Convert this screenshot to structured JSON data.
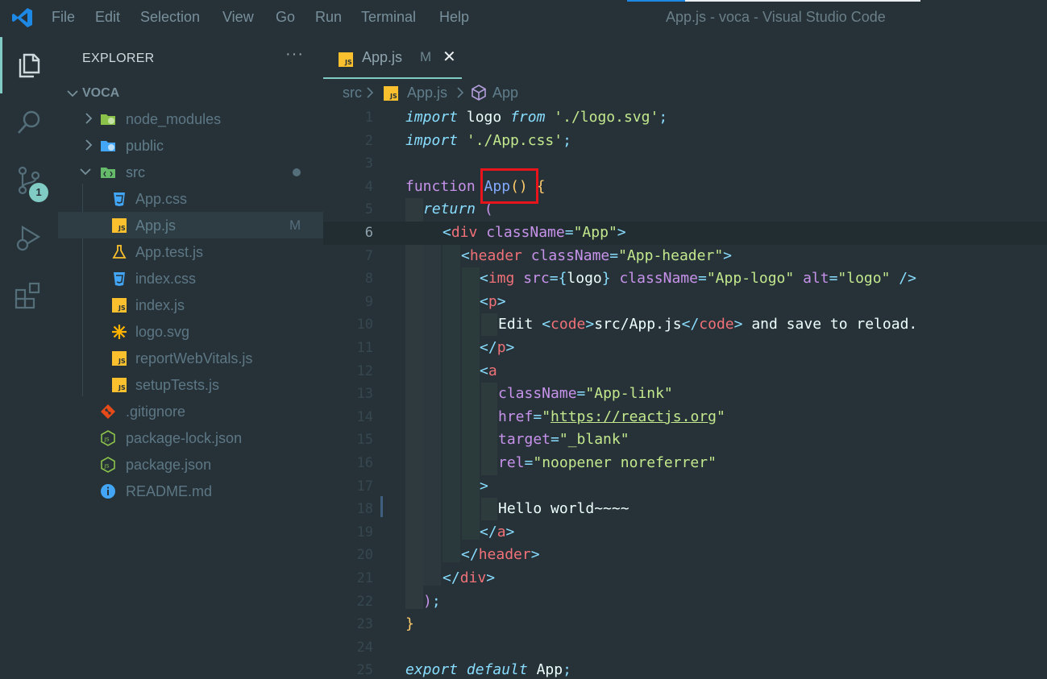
{
  "titlebar": {
    "menu": [
      "File",
      "Edit",
      "Selection",
      "View",
      "Go",
      "Run",
      "Terminal",
      "Help"
    ],
    "window_title": "App.js - voca - Visual Studio Code"
  },
  "activitybar": {
    "icons": [
      "explorer-icon",
      "search-icon",
      "source-control-icon",
      "run-debug-icon",
      "extensions-icon"
    ],
    "scm_badge": "1"
  },
  "sidebar": {
    "title": "EXPLORER",
    "more": "···",
    "folder": "VOCA",
    "items": [
      {
        "label": "node_modules",
        "kind": "folder",
        "icon": "node-folder-icon",
        "expanded": false
      },
      {
        "label": "public",
        "kind": "folder",
        "icon": "public-folder-icon",
        "expanded": false
      },
      {
        "label": "src",
        "kind": "folder",
        "icon": "src-folder-icon",
        "expanded": true,
        "dot": true
      },
      {
        "label": "App.css",
        "kind": "file",
        "icon": "css-icon"
      },
      {
        "label": "App.js",
        "kind": "file",
        "icon": "js-icon",
        "status": "M",
        "selected": true
      },
      {
        "label": "App.test.js",
        "kind": "file",
        "icon": "test-flask-icon"
      },
      {
        "label": "index.css",
        "kind": "file",
        "icon": "css-icon"
      },
      {
        "label": "index.js",
        "kind": "file",
        "icon": "js-icon"
      },
      {
        "label": "logo.svg",
        "kind": "file",
        "icon": "svg-icon"
      },
      {
        "label": "reportWebVitals.js",
        "kind": "file",
        "icon": "js-icon"
      },
      {
        "label": "setupTests.js",
        "kind": "file",
        "icon": "js-icon"
      },
      {
        "label": ".gitignore",
        "kind": "file",
        "icon": "git-icon"
      },
      {
        "label": "package-lock.json",
        "kind": "file",
        "icon": "npm-json-icon"
      },
      {
        "label": "package.json",
        "kind": "file",
        "icon": "npm-json-icon"
      },
      {
        "label": "README.md",
        "kind": "file",
        "icon": "info-icon"
      }
    ]
  },
  "tab": {
    "label": "App.js",
    "modified": "M",
    "close": "✕"
  },
  "breadcrumb": {
    "folder": "src",
    "file": "App.js",
    "symbol": "App"
  },
  "editor": {
    "current_line": 6,
    "lines": [
      {
        "n": "1"
      },
      {
        "n": "2"
      },
      {
        "n": "3"
      },
      {
        "n": "4"
      },
      {
        "n": "5"
      },
      {
        "n": "6"
      },
      {
        "n": "7"
      },
      {
        "n": "8"
      },
      {
        "n": "9"
      },
      {
        "n": "10"
      },
      {
        "n": "11"
      },
      {
        "n": "12"
      },
      {
        "n": "13"
      },
      {
        "n": "14"
      },
      {
        "n": "15"
      },
      {
        "n": "16"
      },
      {
        "n": "17"
      },
      {
        "n": "18"
      },
      {
        "n": "19"
      },
      {
        "n": "20"
      },
      {
        "n": "21"
      },
      {
        "n": "22"
      },
      {
        "n": "23"
      },
      {
        "n": "24"
      },
      {
        "n": "25"
      }
    ],
    "code": {
      "l1": [
        "import",
        " logo ",
        "from",
        " ",
        "'./logo.svg'",
        ";"
      ],
      "l2": [
        "import",
        " ",
        "'./App.css'",
        ";"
      ],
      "l4": [
        "function",
        " ",
        "App",
        "()",
        " ",
        "{"
      ],
      "l5": [
        "return",
        " ",
        "("
      ],
      "l6": [
        "<",
        "div",
        " ",
        "className",
        "=",
        "\"App\"",
        ">"
      ],
      "l7": [
        "<",
        "header",
        " ",
        "className",
        "=",
        "\"App-header\"",
        ">"
      ],
      "l8": [
        "<",
        "img",
        " ",
        "src",
        "=",
        "{",
        "logo",
        "}",
        " ",
        "className",
        "=",
        "\"App-logo\"",
        " ",
        "alt",
        "=",
        "\"logo\"",
        " ",
        "/>"
      ],
      "l9": [
        "<",
        "p",
        ">"
      ],
      "l10": [
        "Edit ",
        "<",
        "code",
        ">",
        "src/App.js",
        "</",
        "code",
        ">",
        " and save to reload."
      ],
      "l11": [
        "</",
        "p",
        ">"
      ],
      "l12": [
        "<",
        "a"
      ],
      "l13": [
        "className",
        "=",
        "\"App-link\""
      ],
      "l14": [
        "href",
        "=",
        "\"",
        "https://reactjs.org",
        "\""
      ],
      "l15": [
        "target",
        "=",
        "\"_blank\""
      ],
      "l16": [
        "rel",
        "=",
        "\"noopener noreferrer\""
      ],
      "l17": [
        ">"
      ],
      "l18": [
        "Hello world~~~~"
      ],
      "l19": [
        "</",
        "a",
        ">"
      ],
      "l20": [
        "</",
        "header",
        ">"
      ],
      "l21": [
        "</",
        "div",
        ">"
      ],
      "l22": [
        ")",
        ";"
      ],
      "l23": [
        "}"
      ],
      "l25": [
        "export",
        " ",
        "default",
        " ",
        "App",
        ";"
      ]
    }
  },
  "colors": {
    "background": "#263238",
    "accent": "#80cbc4",
    "highlight_box": "#e8141c"
  }
}
